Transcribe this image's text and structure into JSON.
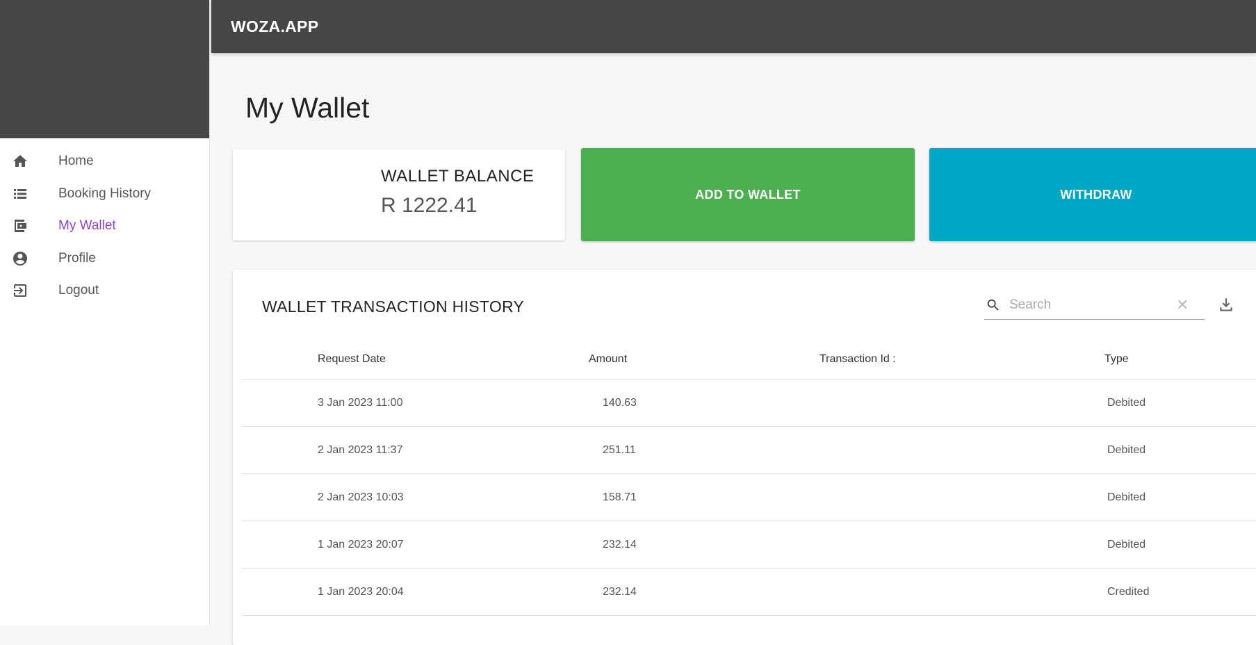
{
  "app": {
    "brand": "WOZA.APP"
  },
  "sidebar": {
    "items": [
      {
        "label": "Home",
        "icon": "home-icon",
        "active": false
      },
      {
        "label": "Booking History",
        "icon": "list-icon",
        "active": false
      },
      {
        "label": "My Wallet",
        "icon": "wallet-icon",
        "active": true
      },
      {
        "label": "Profile",
        "icon": "account-circle-icon",
        "active": false
      },
      {
        "label": "Logout",
        "icon": "logout-icon",
        "active": false
      }
    ]
  },
  "page": {
    "title": "My Wallet"
  },
  "balance": {
    "title": "WALLET BALANCE",
    "value": "R 1222.41"
  },
  "actions": {
    "add_label": "ADD TO WALLET",
    "withdraw_label": "WITHDRAW"
  },
  "colors": {
    "accent": "#8e44c8",
    "add": "#4caf50",
    "withdraw": "#00a6c4",
    "header": "#464646"
  },
  "transactions": {
    "title": "WALLET TRANSACTION HISTORY",
    "search_placeholder": "Search",
    "columns": [
      "Request Date",
      "Amount",
      "Transaction Id :",
      "Type"
    ],
    "rows": [
      {
        "date": "3 Jan 2023 11:00",
        "amount": "140.63",
        "txid": "",
        "type": "Debited"
      },
      {
        "date": "2 Jan 2023 11:37",
        "amount": "251.11",
        "txid": "",
        "type": "Debited"
      },
      {
        "date": "2 Jan 2023 10:03",
        "amount": "158.71",
        "txid": "",
        "type": "Debited"
      },
      {
        "date": "1 Jan 2023 20:07",
        "amount": "232.14",
        "txid": "",
        "type": "Debited"
      },
      {
        "date": "1 Jan 2023 20:04",
        "amount": "232.14",
        "txid": "",
        "type": "Credited"
      }
    ]
  }
}
